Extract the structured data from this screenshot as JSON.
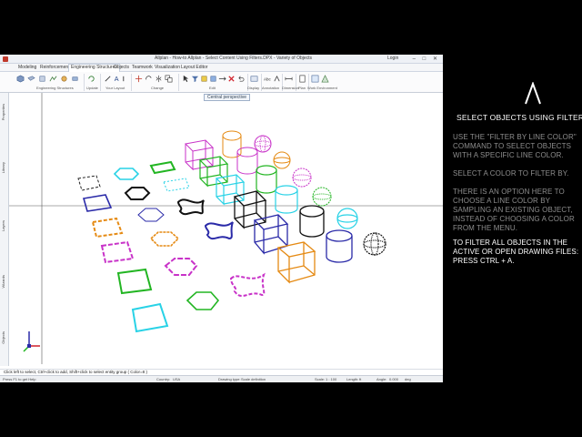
{
  "window": {
    "title": "Allplan - How-to Allplan - Select Content Using Filters.DPX - Variety of Objects",
    "login": "Login",
    "controls": "– □ ✕"
  },
  "tabs": [
    {
      "label": "Modeling"
    },
    {
      "label": "Reinforcement"
    },
    {
      "label": "Engineering Structures"
    },
    {
      "label": "Objects"
    },
    {
      "label": "Teamwork"
    },
    {
      "label": "Visualization"
    },
    {
      "label": "Layout Editor"
    }
  ],
  "ribbon": {
    "groups": [
      {
        "label": "Engineering Structures"
      },
      {
        "label": "Update"
      },
      {
        "label": "Your Layout"
      },
      {
        "label": "Change"
      },
      {
        "label": "Edit"
      },
      {
        "label": "Display"
      },
      {
        "label": "Annotation"
      },
      {
        "label": "Dimension"
      },
      {
        "label": "Plan"
      },
      {
        "label": "Work Environment"
      }
    ]
  },
  "tooltip": "Central perspective",
  "palette_tabs": [
    {
      "label": "Properties"
    },
    {
      "label": "Library"
    },
    {
      "label": "Layers"
    },
    {
      "label": "Wizards"
    },
    {
      "label": "Objects"
    }
  ],
  "command_bar": {
    "message": "Click left to select, Ctrl+click to add, Shift+click to select entity group   ( Color=8 )"
  },
  "status_bar": {
    "help": "Press F1 to get Help",
    "country_label": "Country:",
    "country": "USA",
    "drawing_type_label": "Drawing type:",
    "drawing_type": "Scale definition",
    "scale_label": "Scale:",
    "scale": "1 : 100",
    "length_label": "Length:",
    "length_unit": "ft",
    "angle_label": "Angle:",
    "angle": "0.000",
    "angle_unit": "deg"
  },
  "instructions": {
    "logo_glyph": "Λ",
    "heading": "SELECT OBJECTS USING FILTERS",
    "p1": "USE THE \"FILTER BY LINE COLOR\" COMMAND TO SELECT OBJECTS WITH A SPECIFIC LINE COLOR.",
    "p2": "SELECT A COLOR TO FILTER BY.",
    "p3": "THERE IS AN OPTION HERE TO CHOOSE A LINE COLOR BY SAMPLING AN EXISTING OBJECT, INSTEAD OF CHOOSING A COLOR FROM THE MENU.",
    "p4": "TO FILTER ALL OBJECTS IN THE ACTIVE OR OPEN DRAWING FILES: PRESS CTRL + A."
  },
  "colors": {
    "black": "#111111",
    "blue": "#2a2aa8",
    "orange": "#e58a13",
    "magenta": "#c832c8",
    "green": "#22b522",
    "cyan": "#28d2e6",
    "accent_title": "#c0392b"
  }
}
